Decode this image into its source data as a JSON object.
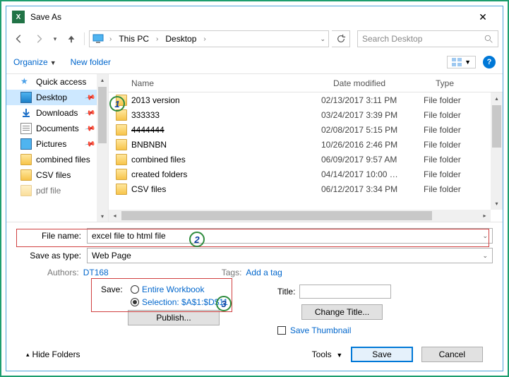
{
  "window": {
    "title": "Save As"
  },
  "nav": {
    "breadcrumb": [
      "This PC",
      "Desktop"
    ],
    "search_placeholder": "Search Desktop"
  },
  "toolbar": {
    "organize": "Organize",
    "new_folder": "New folder"
  },
  "sidebar": {
    "items": [
      {
        "label": "Quick access",
        "icon": "star",
        "pinned": false
      },
      {
        "label": "Desktop",
        "icon": "desktop",
        "pinned": true,
        "selected": true
      },
      {
        "label": "Downloads",
        "icon": "download",
        "pinned": true
      },
      {
        "label": "Documents",
        "icon": "docs",
        "pinned": true
      },
      {
        "label": "Pictures",
        "icon": "pics",
        "pinned": true
      },
      {
        "label": "combined files",
        "icon": "folder",
        "pinned": false
      },
      {
        "label": "CSV files",
        "icon": "folder",
        "pinned": false
      },
      {
        "label": "pdf file",
        "icon": "folder",
        "pinned": false
      }
    ]
  },
  "columns": {
    "name": "Name",
    "date": "Date modified",
    "type": "Type"
  },
  "files": [
    {
      "name": "2013 version",
      "date": "02/13/2017 3:11 PM",
      "type": "File folder"
    },
    {
      "name": "333333",
      "date": "03/24/2017 3:39 PM",
      "type": "File folder"
    },
    {
      "name": "4444444",
      "date": "02/08/2017 5:15 PM",
      "type": "File folder",
      "strike": true
    },
    {
      "name": "BNBNBN",
      "date": "10/26/2016 2:46 PM",
      "type": "File folder"
    },
    {
      "name": "combined files",
      "date": "06/09/2017 9:57 AM",
      "type": "File folder"
    },
    {
      "name": "created folders",
      "date": "04/14/2017 10:00 …",
      "type": "File folder"
    },
    {
      "name": "CSV files",
      "date": "06/12/2017 3:34 PM",
      "type": "File folder"
    }
  ],
  "form": {
    "file_name_label": "File name:",
    "file_name_value": "excel file to html file",
    "save_type_label": "Save as type:",
    "save_type_value": "Web Page",
    "authors_label": "Authors:",
    "authors_value": "DT168",
    "tags_label": "Tags:",
    "tags_value": "Add a tag",
    "save_label": "Save:",
    "opt_workbook": "Entire Workbook",
    "opt_selection": "Selection: $A$1:$D$11",
    "publish_btn": "Publish...",
    "title_label": "Title:",
    "change_title_btn": "Change Title...",
    "save_thumb": "Save Thumbnail"
  },
  "footer": {
    "hide_folders": "Hide Folders",
    "tools": "Tools",
    "save": "Save",
    "cancel": "Cancel"
  },
  "callouts": {
    "c1": "1",
    "c2": "2",
    "c3": "3"
  }
}
